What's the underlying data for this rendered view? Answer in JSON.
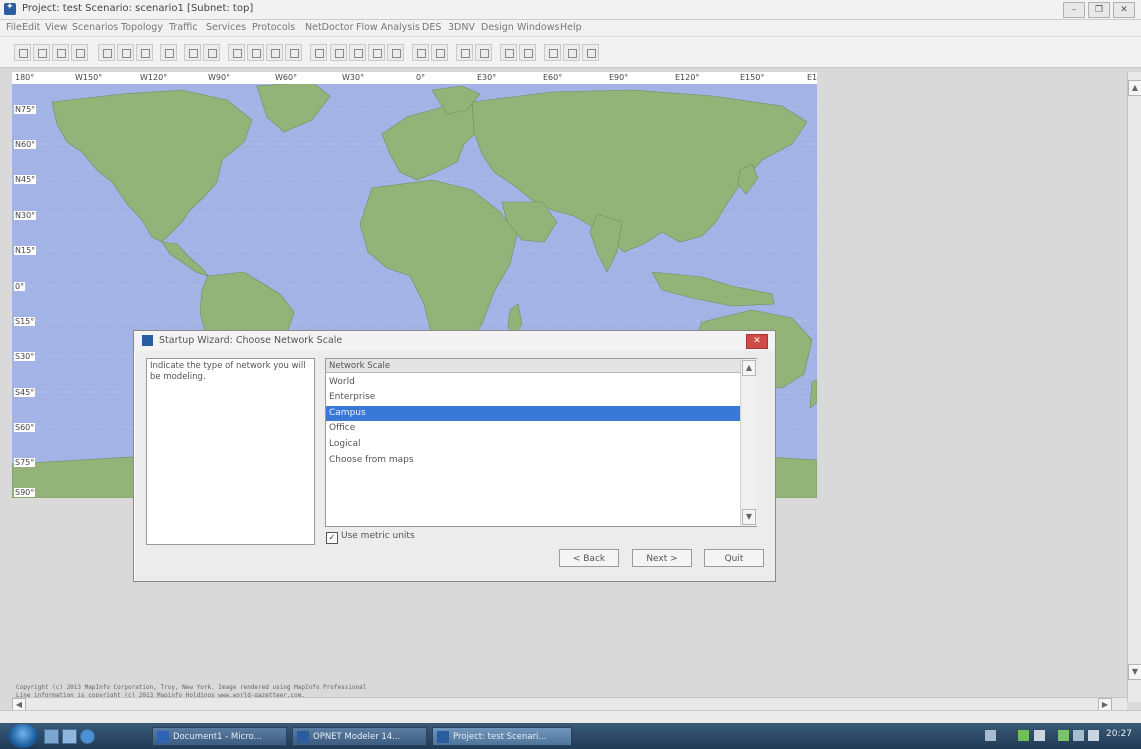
{
  "window": {
    "title": "Project: test Scenario: scenario1 [Subnet: top]",
    "controls": [
      "–",
      "❐",
      "✕"
    ]
  },
  "menu": [
    "File",
    "Edit",
    "View",
    "Scenarios",
    "Topology",
    "Traffic",
    "Services",
    "Protocols",
    "NetDoctor",
    "Flow Analysis",
    "DES",
    "3DNV",
    "Design",
    "Windows",
    "Help"
  ],
  "map": {
    "longitude_labels": [
      "180°",
      "W150°",
      "W120°",
      "W90°",
      "W60°",
      "W30°",
      "0°",
      "E30°",
      "E60°",
      "E90°",
      "E120°",
      "E150°",
      "E1"
    ],
    "latitude_labels": [
      "N75°",
      "N60°",
      "N45°",
      "N30°",
      "N15°",
      "0°",
      "S15°",
      "S30°",
      "S45°",
      "S60°",
      "S75°",
      "S90°"
    ],
    "copyright_line1": "Copyright (c) 2013 MapInfo Corporation, Troy, New York. Image rendered using MapInfo Professional",
    "copyright_line2": "Line information is copyright (c) 2013 Mapinfo Holdings www.world-gazetteer.com."
  },
  "dialog": {
    "title": "Startup Wizard: Choose Network Scale",
    "close": "✕",
    "instruction": "Indicate the type of network you will be modeling.",
    "list_header": "Network Scale",
    "items": [
      "World",
      "Enterprise",
      "Campus",
      "Office",
      "Logical",
      "Choose from maps"
    ],
    "selected_index": 2,
    "checkbox_label": "Use metric units",
    "checkbox_checked": true,
    "buttons": {
      "back": "< Back",
      "next": "Next >",
      "quit": "Quit"
    }
  },
  "taskbar": {
    "items": [
      "Document1 - Micro...",
      "OPNET Modeler 14...",
      "Project: test Scenari..."
    ],
    "clock": "20:27"
  },
  "colors": {
    "ocean": "#a3b3e5",
    "land": "#93b378",
    "selection": "#3a78d8"
  }
}
